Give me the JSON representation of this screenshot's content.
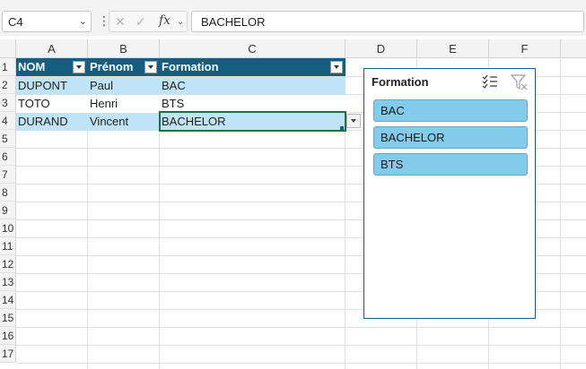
{
  "formula_bar": {
    "name_box": "C4",
    "formula_value": "BACHELOR",
    "fx_label": "fx"
  },
  "columns": [
    "A",
    "B",
    "C",
    "D",
    "E",
    "F"
  ],
  "rows": [
    "1",
    "2",
    "3",
    "4",
    "5",
    "6",
    "7",
    "8",
    "9",
    "10",
    "11",
    "12",
    "13",
    "14",
    "15",
    "16",
    "17"
  ],
  "table": {
    "headers": [
      "NOM",
      "Prénom",
      "Formation"
    ],
    "rows": [
      [
        "DUPONT",
        "Paul",
        "BAC"
      ],
      [
        "TOTO",
        "Henri",
        "BTS"
      ],
      [
        "DURAND",
        "Vincent",
        "BACHELOR"
      ]
    ],
    "header_color": "#155e7f",
    "band_color": "#c0e4f5"
  },
  "slicer": {
    "title": "Formation",
    "items": [
      "BAC",
      "BACHELOR",
      "BTS"
    ],
    "item_color": "#83cbea"
  },
  "icons": [
    "chevron-down-icon",
    "cancel-icon",
    "check-icon",
    "fx-icon",
    "multi-select-icon",
    "clear-filter-icon",
    "filter-dropdown-icon"
  ]
}
